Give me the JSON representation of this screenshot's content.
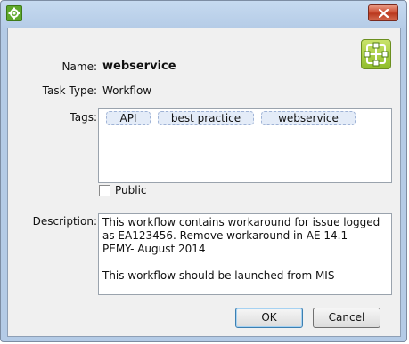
{
  "window": {
    "app_icon": "gear-icon",
    "close_icon": "close-icon"
  },
  "form": {
    "name_label": "Name:",
    "name_value": "webservice",
    "task_type_label": "Task Type:",
    "task_type_value": "Workflow",
    "workflow_icon": "workflow-icon",
    "tags_label": "Tags:",
    "tags": [
      "API",
      "best practice",
      "webservice"
    ],
    "public_label": "Public",
    "public_checked": false,
    "description_label": "Description:",
    "description_value": "This workflow contains workaround for issue logged\nas EA123456. Remove workaround in AE 14.1\nPEMY- August 2014\n\nThis workflow should be launched from MIS"
  },
  "buttons": {
    "ok_label": "OK",
    "cancel_label": "Cancel"
  },
  "colors": {
    "title_bar": "#b4cbe6",
    "close_button": "#c9482c",
    "app_icon": "#5fa82b",
    "tag_background": "#e4ecf8"
  }
}
